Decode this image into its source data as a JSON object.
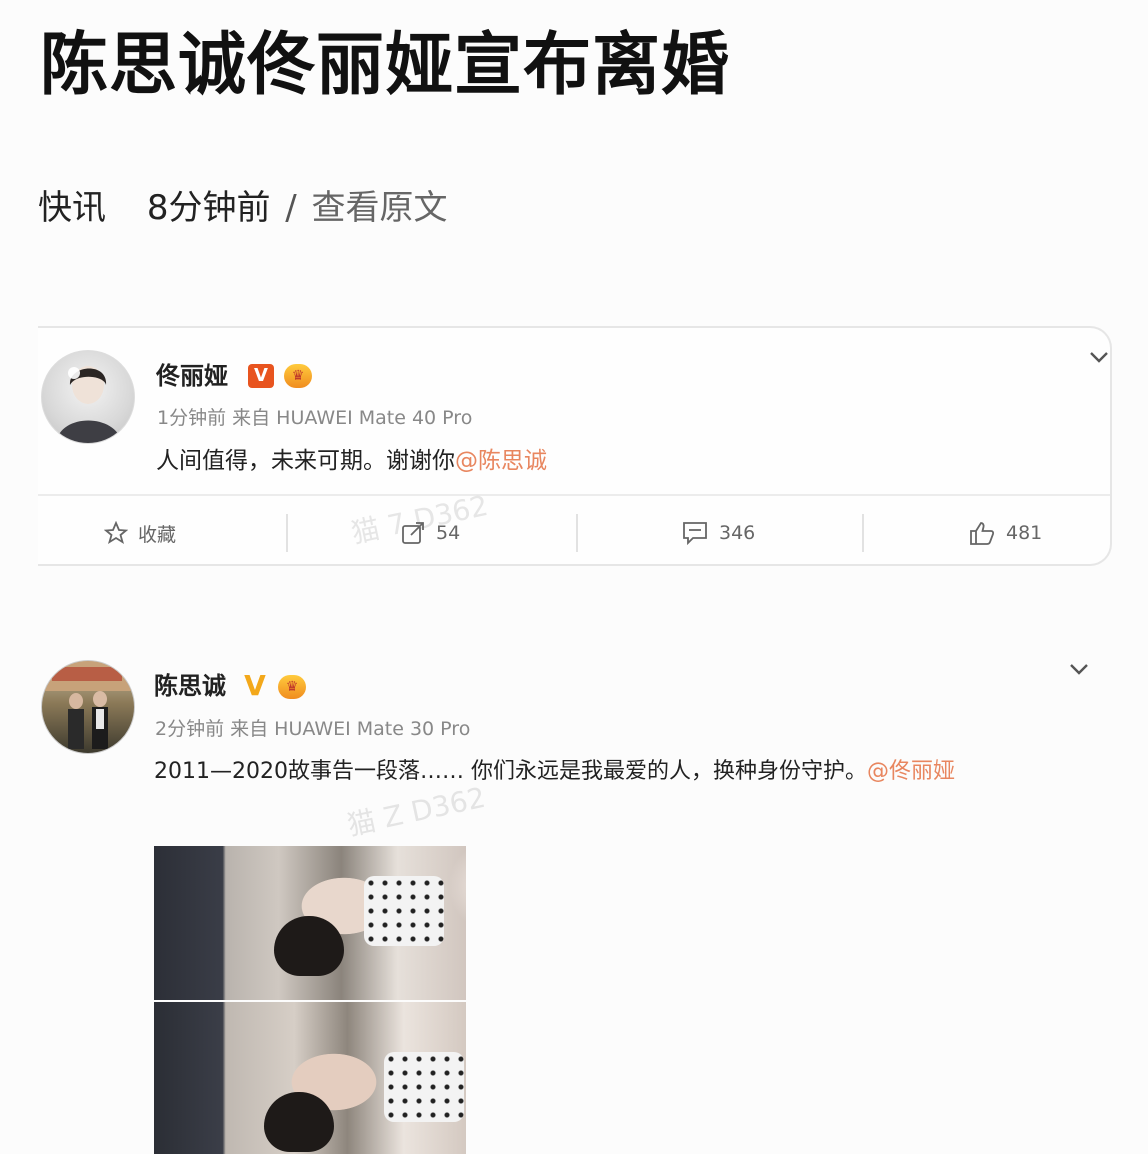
{
  "article": {
    "headline": "陈思诚佟丽娅宣布离婚",
    "category": "快讯",
    "time_ago": "8分钟前",
    "separator": "/",
    "view_source": "查看原文"
  },
  "posts": [
    {
      "author": "佟丽娅",
      "verified_badge": "V",
      "meta": "1分钟前  来自 HUAWEI Mate 40 Pro",
      "text": "人间值得，未来可期。谢谢你",
      "mention": "@陈思诚",
      "actions": {
        "favorite_label": "收藏",
        "repost_count": "54",
        "comment_count": "346",
        "like_count": "481"
      },
      "icons": {
        "favorite": "star-icon",
        "repost": "share-icon",
        "comment": "comment-icon",
        "like": "thumbs-up-icon",
        "menu": "chevron-down-icon"
      }
    },
    {
      "author": "陈思诚",
      "verified_badge": "V",
      "meta": "2分钟前  来自 HUAWEI Mate 30 Pro",
      "text": "2011—2020故事告一段落…… 你们永远是我最爱的人，换种身份守护。",
      "mention": "@佟丽娅",
      "icons": {
        "menu": "chevron-down-icon"
      }
    }
  ],
  "colors": {
    "verified_red": "#e8541f",
    "verified_gold": "#f3a81a",
    "mention": "#e8865f",
    "meta_gray": "#888888"
  }
}
